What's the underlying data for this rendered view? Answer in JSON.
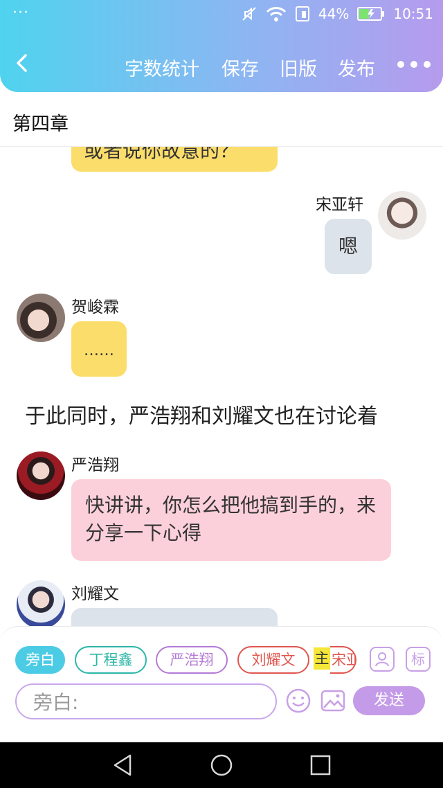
{
  "status_bar": {
    "dots": "···",
    "battery": "44%",
    "time": "10:51"
  },
  "toolbar": {
    "items": [
      "字数统计",
      "保存",
      "旧版",
      "发布"
    ]
  },
  "chapter": {
    "title": "第四章"
  },
  "messages": [
    {
      "type": "bubble",
      "text": "或者说你故意的？",
      "color": "#fbdd6c"
    },
    {
      "type": "right",
      "name": "宋亚轩",
      "text": "嗯",
      "color": "#dde3ea"
    },
    {
      "type": "left",
      "name": "贺峻霖",
      "text": "……",
      "color": "#fbdd6c"
    },
    {
      "type": "narration",
      "text": "于此同时，严浩翔和刘耀文也在讨论着"
    },
    {
      "type": "left",
      "name": "严浩翔",
      "text": "快讲讲，你怎么把他搞到手的，来分享一下心得",
      "color": "#fcd0da"
    },
    {
      "type": "left",
      "name": "刘耀文",
      "text": "",
      "color": "#dde3ea"
    }
  ],
  "composer": {
    "chips": [
      {
        "label": "旁白",
        "color": "#4ccbe5",
        "filled": true
      },
      {
        "label": "丁程鑫",
        "color": "#2ab6a6",
        "filled": false
      },
      {
        "label": "严浩翔",
        "color": "#b47ad6",
        "filled": false
      },
      {
        "label": "刘耀文",
        "color": "#e0554e",
        "filled": false
      },
      {
        "label": "宋亚",
        "color": "#e0554e",
        "filled": false
      }
    ],
    "main_tag": "主",
    "tag_icon_label": "标",
    "input_placeholder": "旁白:",
    "send_label": "发送"
  }
}
